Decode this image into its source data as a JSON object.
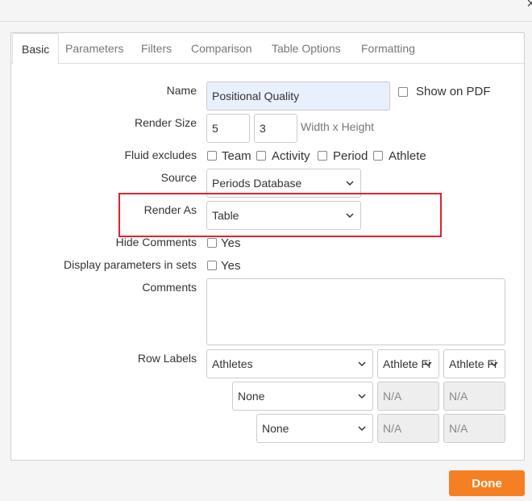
{
  "window": {
    "close_glyph": "×"
  },
  "tabs": [
    {
      "label": "Basic",
      "active": true
    },
    {
      "label": "Parameters"
    },
    {
      "label": "Filters"
    },
    {
      "label": "Comparison"
    },
    {
      "label": "Table Options"
    },
    {
      "label": "Formatting"
    }
  ],
  "form": {
    "name_label": "Name",
    "name_value": "Positional Quality",
    "show_on_pdf_label": "Show on PDF",
    "render_size_label": "Render Size",
    "width_value": "5",
    "height_value": "3",
    "size_hint": "Width x Height",
    "fluid_label": "Fluid excludes",
    "fluid_options": [
      "Team",
      "Activity",
      "Period",
      "Athlete"
    ],
    "source_label": "Source",
    "source_value": "Periods Database",
    "render_as_label": "Render As",
    "render_as_value": "Table",
    "hide_comments_label": "Hide Comments",
    "hide_comments_option": "Yes",
    "display_params_label": "Display parameters in sets",
    "display_params_option": "Yes",
    "comments_label": "Comments",
    "row_labels_label": "Row Labels",
    "row_labels": [
      {
        "select": "Athletes",
        "col2": "Athlete Fi",
        "col3": "Athlete Fi"
      },
      {
        "select": "None",
        "col2": "N/A",
        "col3": "N/A"
      },
      {
        "select": "None",
        "col2": "N/A",
        "col3": "N/A"
      }
    ]
  },
  "footer": {
    "done_label": "Done"
  },
  "colors": {
    "accent": "#f58023",
    "highlight": "#e0232b",
    "name_field_bg": "#e8f0fe"
  },
  "icons": [
    "chevron-down-icon",
    "close-icon"
  ]
}
